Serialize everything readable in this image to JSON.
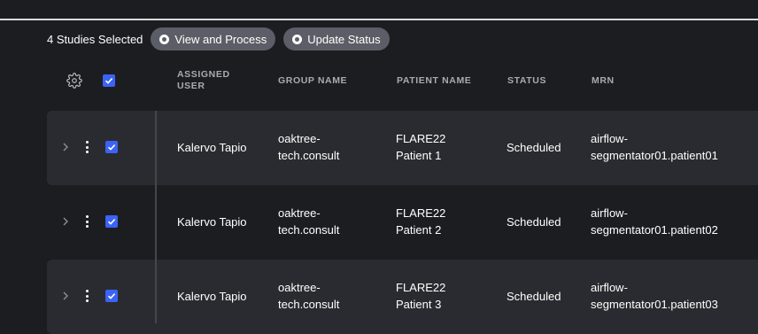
{
  "selection": {
    "count_label": "4 Studies Selected",
    "actions": [
      {
        "label": "View and Process",
        "icon": "process-icon"
      },
      {
        "label": "Update Status",
        "icon": "status-icon"
      }
    ]
  },
  "table": {
    "columns": {
      "assigned_user_line1": "ASSIGNED",
      "assigned_user_line2": "USER",
      "group_name": "GROUP NAME",
      "patient_name": "PATIENT NAME",
      "status": "STATUS",
      "mrn": "MRN"
    },
    "rows": [
      {
        "assigned_user": "Kalervo Tapio",
        "group_line1": "oaktree-",
        "group_line2": "tech.consult",
        "patient_line1": "FLARE22",
        "patient_line2": "Patient 1",
        "status": "Scheduled",
        "mrn_line1": "airflow-",
        "mrn_line2": "segmentator01.patient01"
      },
      {
        "assigned_user": "Kalervo Tapio",
        "group_line1": "oaktree-",
        "group_line2": "tech.consult",
        "patient_line1": "FLARE22",
        "patient_line2": "Patient 2",
        "status": "Scheduled",
        "mrn_line1": "airflow-",
        "mrn_line2": "segmentator01.patient02"
      },
      {
        "assigned_user": "Kalervo Tapio",
        "group_line1": "oaktree-",
        "group_line2": "tech.consult",
        "patient_line1": "FLARE22",
        "patient_line2": "Patient 3",
        "status": "Scheduled",
        "mrn_line1": "airflow-",
        "mrn_line2": "segmentator01.patient03"
      }
    ]
  },
  "colors": {
    "background": "#1c1d21",
    "row_alt": "#2a2b30",
    "accent_checkbox": "#3b63f5",
    "pill": "#5b5e66"
  }
}
